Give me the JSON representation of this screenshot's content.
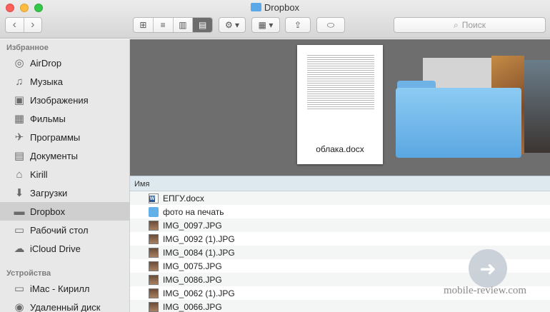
{
  "window": {
    "title": "Dropbox"
  },
  "toolbar": {
    "back": "‹",
    "forward": "›",
    "view_icons": "⊞",
    "view_list": "≡",
    "view_columns": "▥",
    "view_coverflow": "▤",
    "gear": "⚙ ▾",
    "arrange": "▦ ▾",
    "share": "⇪",
    "tag": "⬭",
    "search_placeholder": "Поиск"
  },
  "sidebar": {
    "favorites_header": "Избранное",
    "favorites": [
      {
        "label": "AirDrop",
        "icon": "airdrop-icon",
        "glyph": "◎"
      },
      {
        "label": "Музыка",
        "icon": "music-icon",
        "glyph": "♫"
      },
      {
        "label": "Изображения",
        "icon": "camera-icon",
        "glyph": "▣"
      },
      {
        "label": "Фильмы",
        "icon": "film-icon",
        "glyph": "▦"
      },
      {
        "label": "Программы",
        "icon": "apps-icon",
        "glyph": "✈"
      },
      {
        "label": "Документы",
        "icon": "document-icon",
        "glyph": "▤"
      },
      {
        "label": "Kirill",
        "icon": "home-icon",
        "glyph": "⌂"
      },
      {
        "label": "Загрузки",
        "icon": "downloads-icon",
        "glyph": "⬇"
      },
      {
        "label": "Dropbox",
        "icon": "folder-icon",
        "glyph": "▬"
      },
      {
        "label": "Рабочий стол",
        "icon": "desktop-icon",
        "glyph": "▭"
      },
      {
        "label": "iCloud Drive",
        "icon": "cloud-icon",
        "glyph": "☁"
      }
    ],
    "devices_header": "Устройства",
    "devices": [
      {
        "label": "iMac - Кирилл",
        "icon": "imac-icon",
        "glyph": "▭"
      },
      {
        "label": "Удаленный диск",
        "icon": "disc-icon",
        "glyph": "◉"
      }
    ]
  },
  "preview": {
    "document_name": "облака.docx"
  },
  "list": {
    "column_name": "Имя",
    "files": [
      {
        "name": "ЕПГУ.docx",
        "type": "word"
      },
      {
        "name": "фото на печать",
        "type": "folder"
      },
      {
        "name": "IMG_0097.JPG",
        "type": "jpg"
      },
      {
        "name": "IMG_0092 (1).JPG",
        "type": "jpg"
      },
      {
        "name": "IMG_0084 (1).JPG",
        "type": "jpg"
      },
      {
        "name": "IMG_0075.JPG",
        "type": "jpg"
      },
      {
        "name": "IMG_0086.JPG",
        "type": "jpg"
      },
      {
        "name": "IMG_0062 (1).JPG",
        "type": "jpg"
      },
      {
        "name": "IMG_0066.JPG",
        "type": "jpg"
      }
    ]
  },
  "watermark": {
    "text": "mobile-review.com"
  }
}
